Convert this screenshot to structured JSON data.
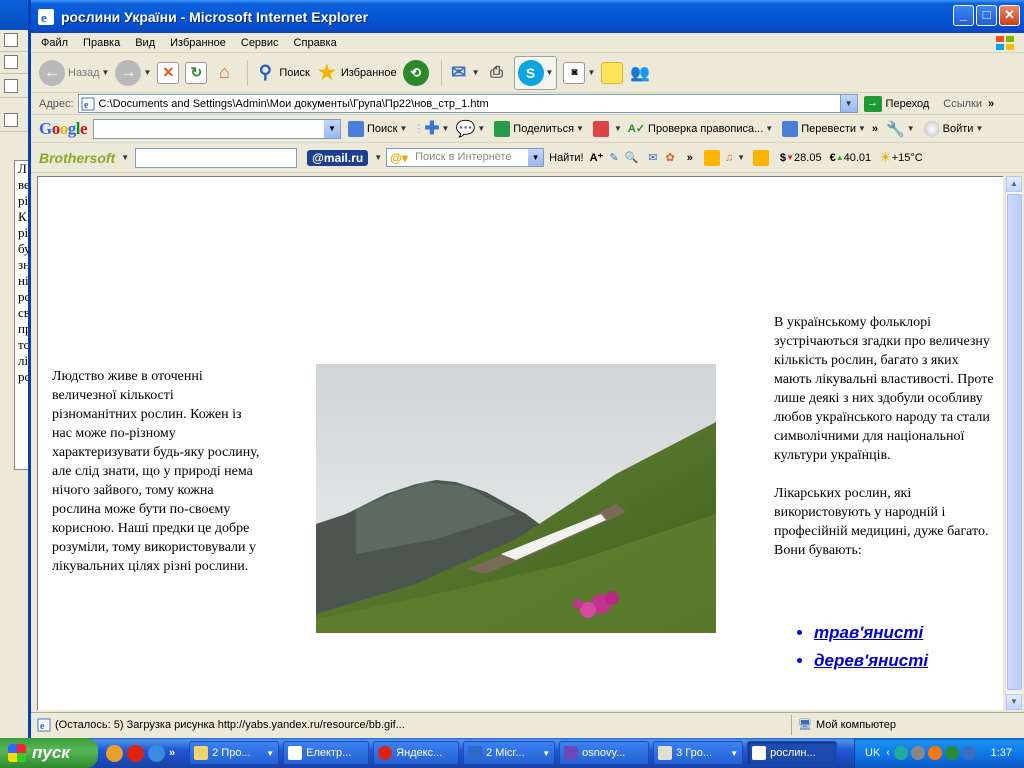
{
  "window": {
    "title": "рослини України - Microsoft Internet Explorer"
  },
  "menu": [
    "Файл",
    "Правка",
    "Вид",
    "Избранное",
    "Сервис",
    "Справка"
  ],
  "toolbar": {
    "back": "Назад",
    "search": "Поиск",
    "favorites": "Избранное"
  },
  "address": {
    "label": "Адрес:",
    "url": "C:\\Documents and Settings\\Admin\\Мои документы\\Група\\Пр22\\нов_стр_1.htm",
    "go": "Переход",
    "links": "Ссылки"
  },
  "google_bar": {
    "logo": "Google",
    "search": "Поиск",
    "share": "Поделиться",
    "spell": "Проверка правописа...",
    "translate": "Перевести",
    "signin": "Войти"
  },
  "brothersoft_bar": {
    "logo": "Brothersoft",
    "mail": "@mail.ru",
    "search_placeholder": "Поиск в Интернете",
    "find": "Найти!",
    "usd": "28.05",
    "eur": "40.01",
    "temp": "+15°C"
  },
  "page": {
    "left_text": "Людство живе в оточенні величезної кількості різноманітних рослин. Кожен із нас може по-різному характеризувати будь-яку рослину, але слід знати, що у природі нема нічого зайвого, тому кожна рослина може бути по-своєму корисною. Наші предки це добре розуміли, тому використовували у лікувальних цілях різні рослини.",
    "right_p1": "В українському фольклорі зустрічаються згадки про величезну кількість рослин, багато з яких мають лікувальні властивості. Проте лише деякі з них здобули особливу любов українського народу та стали символічними для національної культури українців.",
    "right_p2": "Лікарських рослин, які використовують у народній і професійній медицині, дуже багато. Вони бувають:",
    "links": [
      "трав'янисті",
      "дерев'янисті"
    ]
  },
  "status": {
    "message": "(Осталось: 5) Загрузка рисунка http://yabs.yandex.ru/resource/bb.gif...",
    "zone": "Мой компьютер"
  },
  "taskbar": {
    "start": "пуск",
    "tasks": [
      "2 Про...",
      "Електр...",
      "Яндекс...",
      "2 Micr...",
      "osnovy...",
      "3 Гро...",
      "рослин..."
    ],
    "lang": "UK",
    "clock": "1:37"
  },
  "background_window": {
    "doc_chars": [
      "Л",
      "ве",
      "рі",
      "К",
      "рі",
      "бу",
      "зн",
      "ні",
      "ро",
      "св",
      "пр",
      "то",
      "лі",
      "ро"
    ]
  }
}
